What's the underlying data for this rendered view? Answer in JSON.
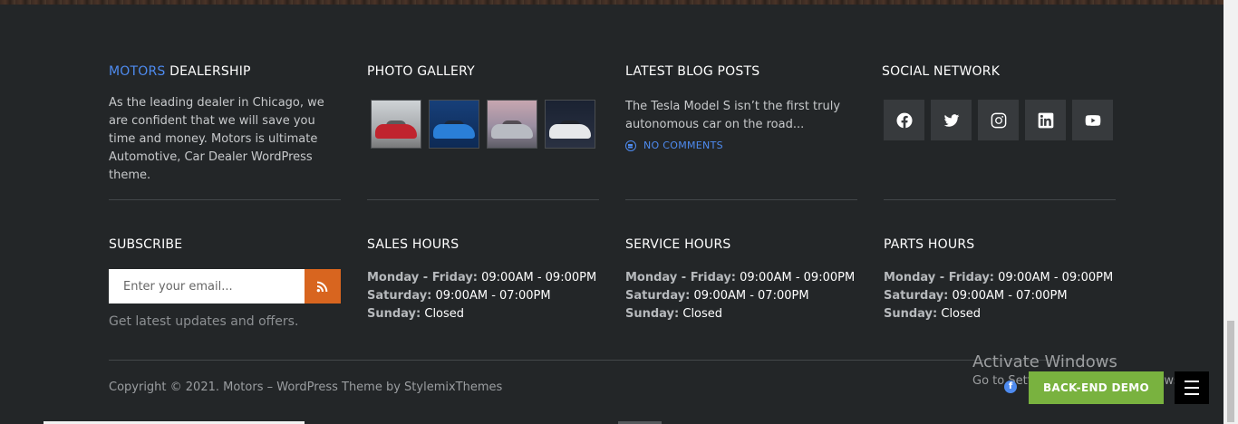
{
  "about": {
    "heading_accent": "MOTORS",
    "heading_rest": " DEALERSHIP",
    "text": "As the leading dealer in Chicago, we are confident that we will save you time and money. Motors is ultimate Automotive, Car Dealer WordPress theme."
  },
  "gallery": {
    "heading": "PHOTO GALLERY"
  },
  "blog": {
    "heading": "LATEST BLOG POSTS",
    "post_text": "The Tesla Model S isn’t the first truly autonomous car on the road...",
    "comments": "NO COMMENTS"
  },
  "social": {
    "heading": "SOCIAL NETWORK"
  },
  "subscribe": {
    "heading": "SUBSCRIBE",
    "placeholder": "Enter your email...",
    "note": "Get latest updates and offers."
  },
  "sales": {
    "heading": "SALES HOURS",
    "weekday_label": "Monday - Friday:",
    "weekday_value": " 09:00AM - 09:00PM",
    "saturday_label": "Saturday:",
    "saturday_value": " 09:00AM - 07:00PM",
    "sunday_label": "Sunday:",
    "sunday_value": " Closed"
  },
  "service": {
    "heading": "SERVICE HOURS",
    "weekday_label": "Monday - Friday:",
    "weekday_value": " 09:00AM - 09:00PM",
    "saturday_label": "Saturday:",
    "saturday_value": " 09:00AM - 07:00PM",
    "sunday_label": "Sunday:",
    "sunday_value": " Closed"
  },
  "parts": {
    "heading": "PARTS HOURS",
    "weekday_label": "Monday - Friday:",
    "weekday_value": " 09:00AM - 09:00PM",
    "saturday_label": "Saturday:",
    "saturday_value": " 09:00AM - 07:00PM",
    "sunday_label": "Sunday:",
    "sunday_value": " Closed"
  },
  "footer": {
    "copyright": "Copyright © 2021. Motors – WordPress Theme by StylemixThemes",
    "demo_button": "BACK-END DEMO"
  },
  "watermark": {
    "title": "Activate Windows",
    "subtitle": "Go to Settings to activate Windows."
  },
  "colors": {
    "background": "#232628",
    "accent_blue": "#4e8bf0",
    "rss_orange": "#d8651f",
    "demo_green": "#79b23f"
  }
}
